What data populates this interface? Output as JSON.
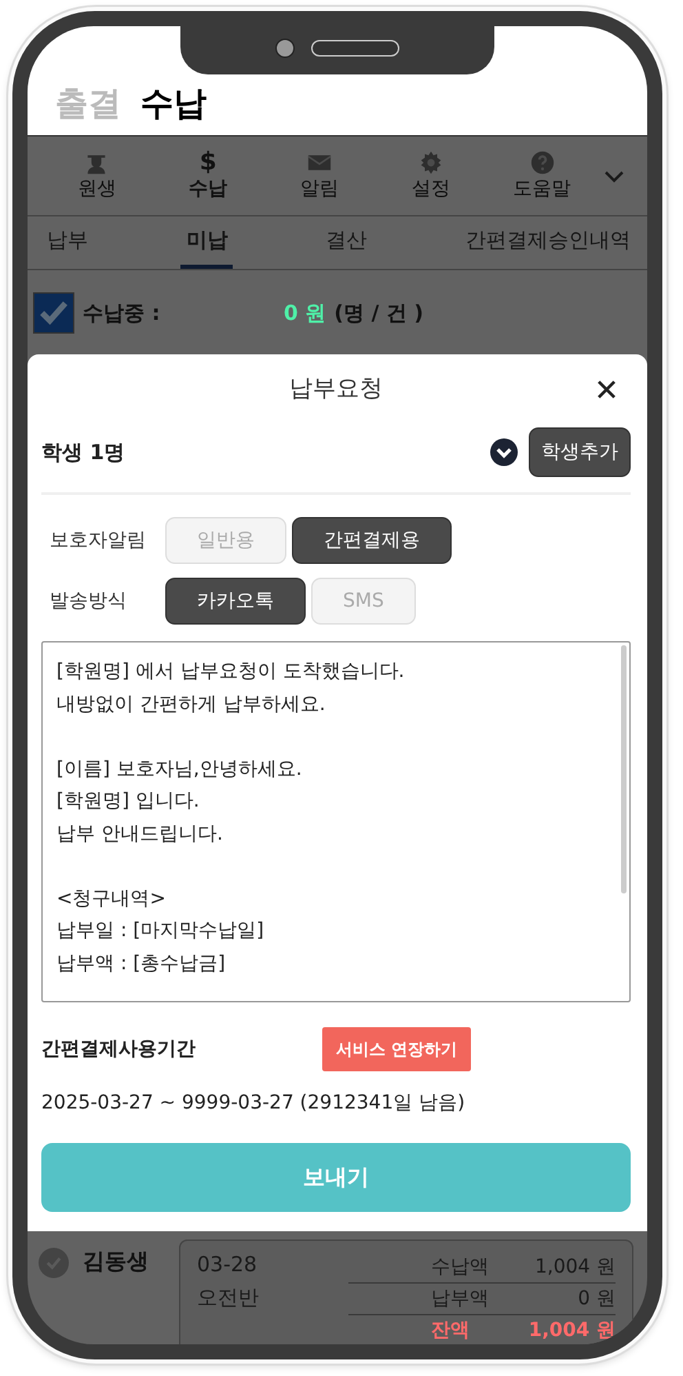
{
  "header_tabs": [
    {
      "label": "출결",
      "selected": false
    },
    {
      "label": "수납",
      "selected": true
    }
  ],
  "toolbar": [
    {
      "kind": "student",
      "label": "원생",
      "selected": false
    },
    {
      "kind": "glyph",
      "glyph": "$",
      "label": "수납",
      "selected": true
    },
    {
      "kind": "mail",
      "label": "알림",
      "selected": false
    },
    {
      "kind": "gear",
      "label": "설정",
      "selected": false
    },
    {
      "kind": "help",
      "label": "도움말",
      "selected": false
    }
  ],
  "sub_tabs": [
    {
      "label": "납부",
      "selected": false
    },
    {
      "label": "미납",
      "selected": true
    },
    {
      "label": "결산",
      "selected": false
    },
    {
      "label": "간편결제승인내역",
      "selected": false
    }
  ],
  "summary": {
    "checked": true,
    "label": "수납중 :",
    "amount": "0 원",
    "count": "(명 / 건 )"
  },
  "modal": {
    "title": "납부요청",
    "students": "학생 1명",
    "add_button": "학생추가",
    "options": [
      {
        "label": "보호자알림",
        "choices": [
          {
            "label": "일반용",
            "selected": false
          },
          {
            "label": "간편결제용",
            "selected": true
          }
        ]
      },
      {
        "label": "발송방식",
        "choices": [
          {
            "label": "카카오톡",
            "selected": true
          },
          {
            "label": "SMS",
            "selected": false
          }
        ]
      }
    ],
    "message": "[학원명] 에서 납부요청이 도착했습니다.\n내방없이 간편하게 납부하세요.\n\n[이름] 보호자님,안녕하세요.\n[학원명] 입니다.\n납부 안내드립니다.\n\n<청구내역>\n납부일 : [마지막수납일]\n납부액 : [총수납금]",
    "period_label": "간편결제사용기간",
    "extend_button": "서비스 연장하기",
    "period": "2025-03-27 ~ 9999-03-27 (2912341일 남음)",
    "send_button": "보내기"
  },
  "student_row": {
    "name": "김동생",
    "checked": false,
    "date": "03-28",
    "class": "오전반",
    "amounts": [
      {
        "kind": "normal",
        "label": "수납액",
        "value": "1,004 원"
      },
      {
        "kind": "normal",
        "label": "납부액",
        "value": "0 원"
      },
      {
        "kind": "balance",
        "label": "잔액",
        "value": "1,004 원"
      }
    ]
  }
}
